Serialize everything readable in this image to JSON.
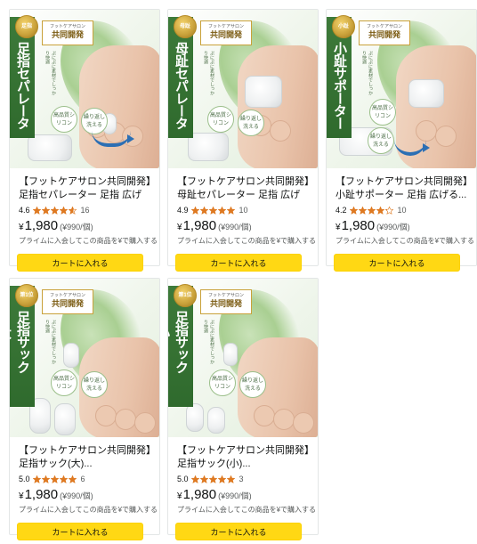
{
  "products": [
    {
      "banner": "足指セパレーター",
      "image_badge": "フットケアサロン共同開発",
      "image_badge_small": "フットケアサロン",
      "image_copy": "ぷにぷに素材でしっかり快適",
      "image_tag1": "高品質シリコン",
      "image_tag2": "繰り返し洗える",
      "medal": "足指",
      "title": "【フットケアサロン共同開発】足指セパレーター 足指 広げる...",
      "rating_value": "4.6",
      "rating_stars": 4.6,
      "review_count": "16",
      "price_symbol": "¥",
      "price": "1,980",
      "unit_price": "(¥990/個)",
      "prime_text": "プライムに入会してこの商品を¥で購入する",
      "cart_label": "カートに入れる",
      "accent": "#2c6fb4"
    },
    {
      "banner": "母趾セパレーター",
      "image_badge": "フットケアサロン共同開発",
      "image_badge_small": "フットケアサロン",
      "image_copy": "ぷにぷに素材でしっかり快適",
      "image_tag1": "高品質シリコン",
      "image_tag2": "繰り返し洗える",
      "medal": "母趾",
      "title": "【フットケアサロン共同開発】母趾セパレーター 足指 広げる...",
      "rating_value": "4.9",
      "rating_stars": 4.9,
      "review_count": "10",
      "price_symbol": "¥",
      "price": "1,980",
      "unit_price": "(¥990/個)",
      "prime_text": "プライムに入会してこの商品を¥で購入する",
      "cart_label": "カートに入れる",
      "accent": "#2c6fb4"
    },
    {
      "banner": "小趾サポーター",
      "image_badge": "フットケアサロン共同開発",
      "image_badge_small": "フットケアサロン",
      "image_copy": "ぷにぷに素材でしっかり快適",
      "image_tag1": "高品質シリコン",
      "image_tag2": "繰り返し洗える",
      "medal": "小趾",
      "title": "【フットケアサロン共同開発】小趾サポーター 足指 広げる...",
      "rating_value": "4.2",
      "rating_stars": 4.2,
      "review_count": "10",
      "price_symbol": "¥",
      "price": "1,980",
      "unit_price": "(¥990/個)",
      "prime_text": "プライムに入会してこの商品を¥で購入する",
      "cart_label": "カートに入れる",
      "accent": "#2c6fb4"
    },
    {
      "banner": "足指サック(大)",
      "image_badge": "フットケアサロン共同開発",
      "image_badge_small": "フットケアサロン",
      "image_copy": "ぷにぷに素材でしっかり快適",
      "image_tag1": "高品質シリコン",
      "image_tag2": "繰り返し洗える",
      "medal": "第1位",
      "title": "【フットケアサロン共同開発】足指サック(大)...",
      "rating_value": "5.0",
      "rating_stars": 5.0,
      "review_count": "6",
      "price_symbol": "¥",
      "price": "1,980",
      "unit_price": "(¥990/個)",
      "prime_text": "プライムに入会してこの商品を¥で購入する",
      "cart_label": "カートに入れる",
      "accent": "#2c6fb4"
    },
    {
      "banner": "足指サック(小)",
      "image_badge": "フットケアサロン共同開発",
      "image_badge_small": "フットケアサロン",
      "image_copy": "ぷにぷに素材でしっかり快適",
      "image_tag1": "高品質シリコン",
      "image_tag2": "繰り返し洗える",
      "medal": "第1位",
      "title": "【フットケアサロン共同開発】足指サック(小)...",
      "rating_value": "5.0",
      "rating_stars": 5.0,
      "review_count": "3",
      "price_symbol": "¥",
      "price": "1,980",
      "unit_price": "(¥990/個)",
      "prime_text": "プライムに入会してこの商品を¥で購入する",
      "cart_label": "カートに入れる",
      "accent": "#2c6fb4"
    }
  ],
  "colors": {
    "star": "#de7921",
    "star_empty": "#ffffff",
    "cart_button": "#ffd814",
    "banner_green": "#3d7a3a"
  }
}
